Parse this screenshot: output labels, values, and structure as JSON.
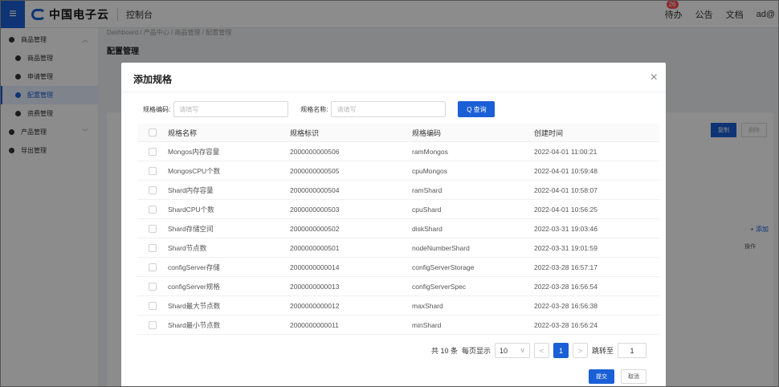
{
  "header": {
    "logo_text": "中国电子云",
    "console_label": "控制台",
    "todo_label": "待办",
    "todo_badge": "26",
    "notice_label": "公告",
    "docs_label": "文档",
    "user_label": "ad@"
  },
  "sidebar": {
    "items": [
      {
        "label": "商品管理"
      },
      {
        "label": "商品管理"
      },
      {
        "label": "申请管理"
      },
      {
        "label": "配置管理"
      },
      {
        "label": "资费管理"
      },
      {
        "label": "产品管理"
      },
      {
        "label": "导出管理"
      }
    ]
  },
  "main": {
    "breadcrumb": "Dashboard / 产品中心 / 商品管理 / 配置管理",
    "title": "配置管理",
    "btn_copy": "复制",
    "btn_delete": "删除",
    "add_link": "+ 添加",
    "op_header": "操作"
  },
  "modal": {
    "title": "添加规格",
    "close_icon": "×",
    "search": {
      "code_label": "规格编码:",
      "code_placeholder": "请填写",
      "name_label": "规格名称:",
      "name_placeholder": "请填写",
      "query_button": "Q 查询"
    },
    "table": {
      "headers": [
        "规格名称",
        "规格标识",
        "规格编码",
        "创建时间"
      ],
      "rows": [
        [
          "Mongos内存容量",
          "2000000000506",
          "ramMongos",
          "2022-04-01 11:00:21"
        ],
        [
          "MongosCPU个数",
          "2000000000505",
          "cpuMongos",
          "2022-04-01 10:59:48"
        ],
        [
          "Shard内存容量",
          "2000000000504",
          "ramShard",
          "2022-04-01 10:58:07"
        ],
        [
          "ShardCPU个数",
          "2000000000503",
          "cpuShard",
          "2022-04-01 10:56:25"
        ],
        [
          "Shard存储空间",
          "2000000000502",
          "diskShard",
          "2022-03-31 19:03:46"
        ],
        [
          "Shard节点数",
          "2000000000501",
          "nodeNumberShard",
          "2022-03-31 19:01:59"
        ],
        [
          "configServer存储",
          "2000000000014",
          "configServerStorage",
          "2022-03-28 16:57:17"
        ],
        [
          "configServer规格",
          "2000000000013",
          "configServerSpec",
          "2022-03-28 16:56:54"
        ],
        [
          "Shard最大节点数",
          "2000000000012",
          "maxShard",
          "2022-03-28 16:56:38"
        ],
        [
          "Shard最小节点数",
          "2000000000011",
          "minShard",
          "2022-03-28 16:56:24"
        ]
      ]
    },
    "pager": {
      "total": "共 10 条",
      "per_page_label": "每页显示",
      "per_page_value": "10",
      "prev": "<",
      "current": "1",
      "next": ">",
      "jump_label": "跳转至",
      "jump_value": "1"
    },
    "footer": {
      "submit": "提交",
      "cancel": "取消"
    }
  }
}
